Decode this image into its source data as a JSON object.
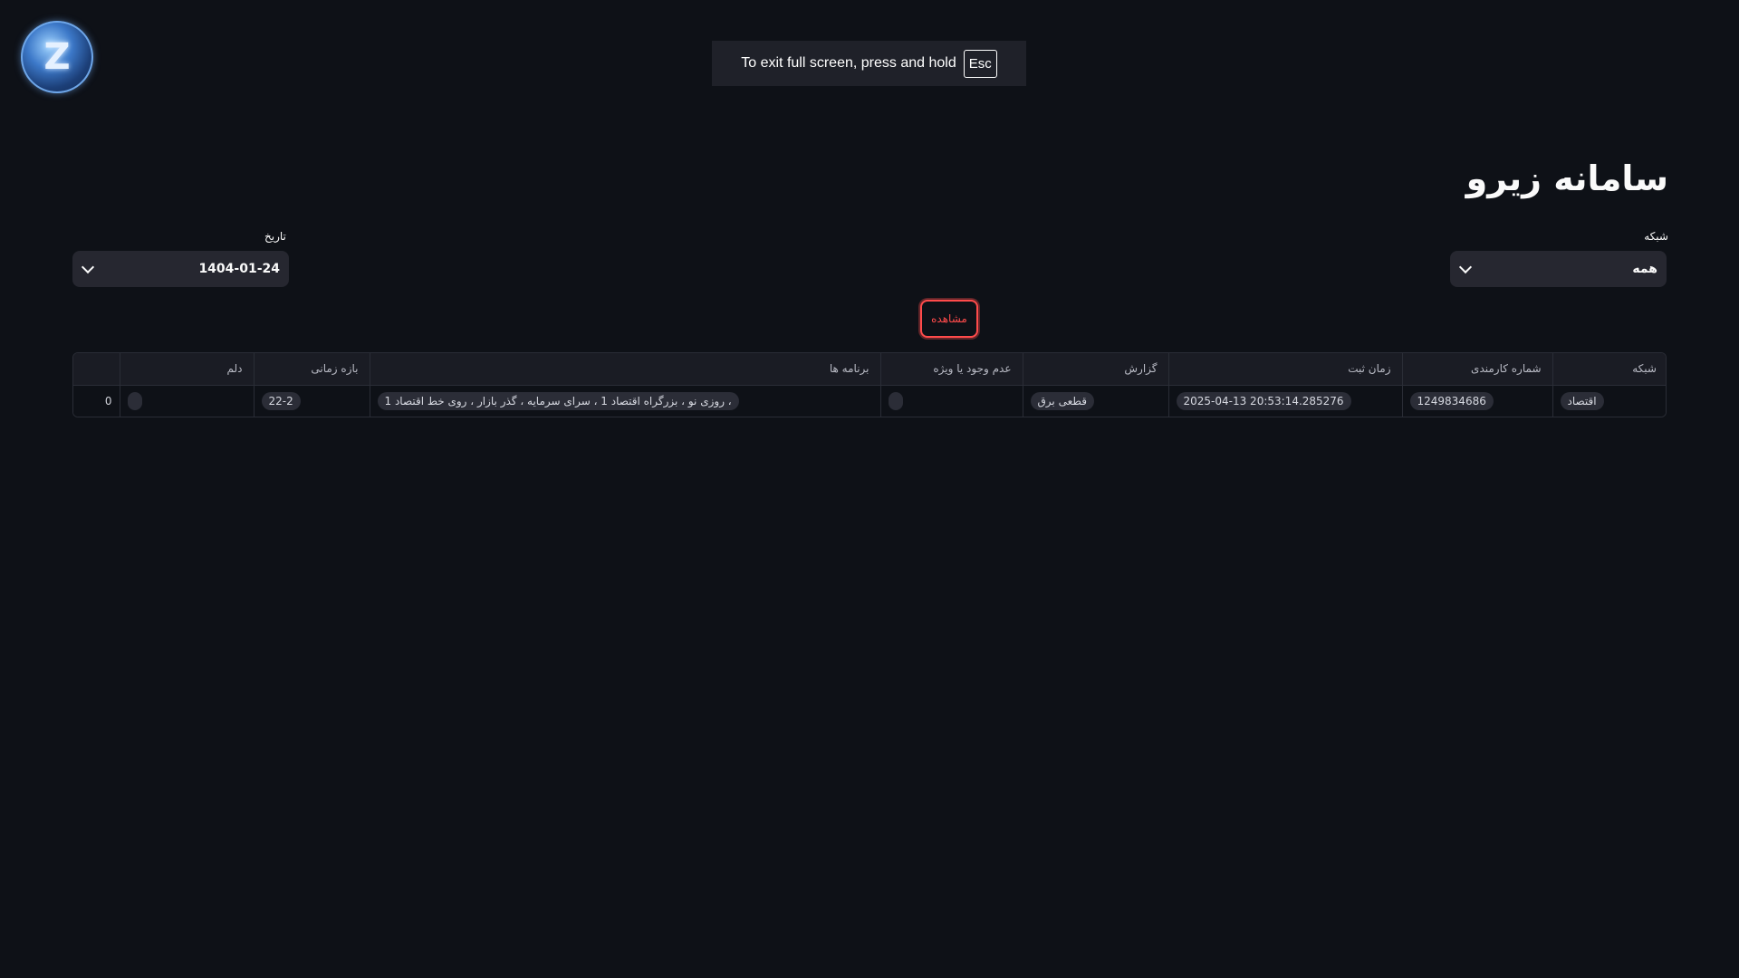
{
  "logo": {
    "letter": "Z"
  },
  "fullscreen_banner": {
    "text": "To exit full screen, press and hold",
    "key": "Esc"
  },
  "title": "سامانه زیرو",
  "network_select": {
    "label": "شبکه",
    "value": "همه"
  },
  "date_select": {
    "label": "تاریخ",
    "value": "1404-01-24"
  },
  "view_button": {
    "label": "مشاهده"
  },
  "table": {
    "headers": {
      "network": "شبکه",
      "employee_id": "شماره کارمندی",
      "reg_time": "زمان ثبت",
      "report": "گزارش",
      "special": "عدم وجود یا ویژه",
      "programs": "برنامه ها",
      "time_range": "بازه زمانی",
      "tail": "دلم",
      "index": ""
    },
    "rows": [
      {
        "index": "0",
        "tail": "",
        "time_range": "22-2",
        "programs": "، روزی نو ، بزرگراه اقتصاد 1 ، سرای سرمایه ، گذر بازار ، روی خط اقتصاد 1",
        "special": "",
        "report": "قطعی برق",
        "reg_time": "2025-04-13 20:53:14.285276",
        "employee_id": "1249834686",
        "network": "اقتصاد"
      }
    ]
  }
}
